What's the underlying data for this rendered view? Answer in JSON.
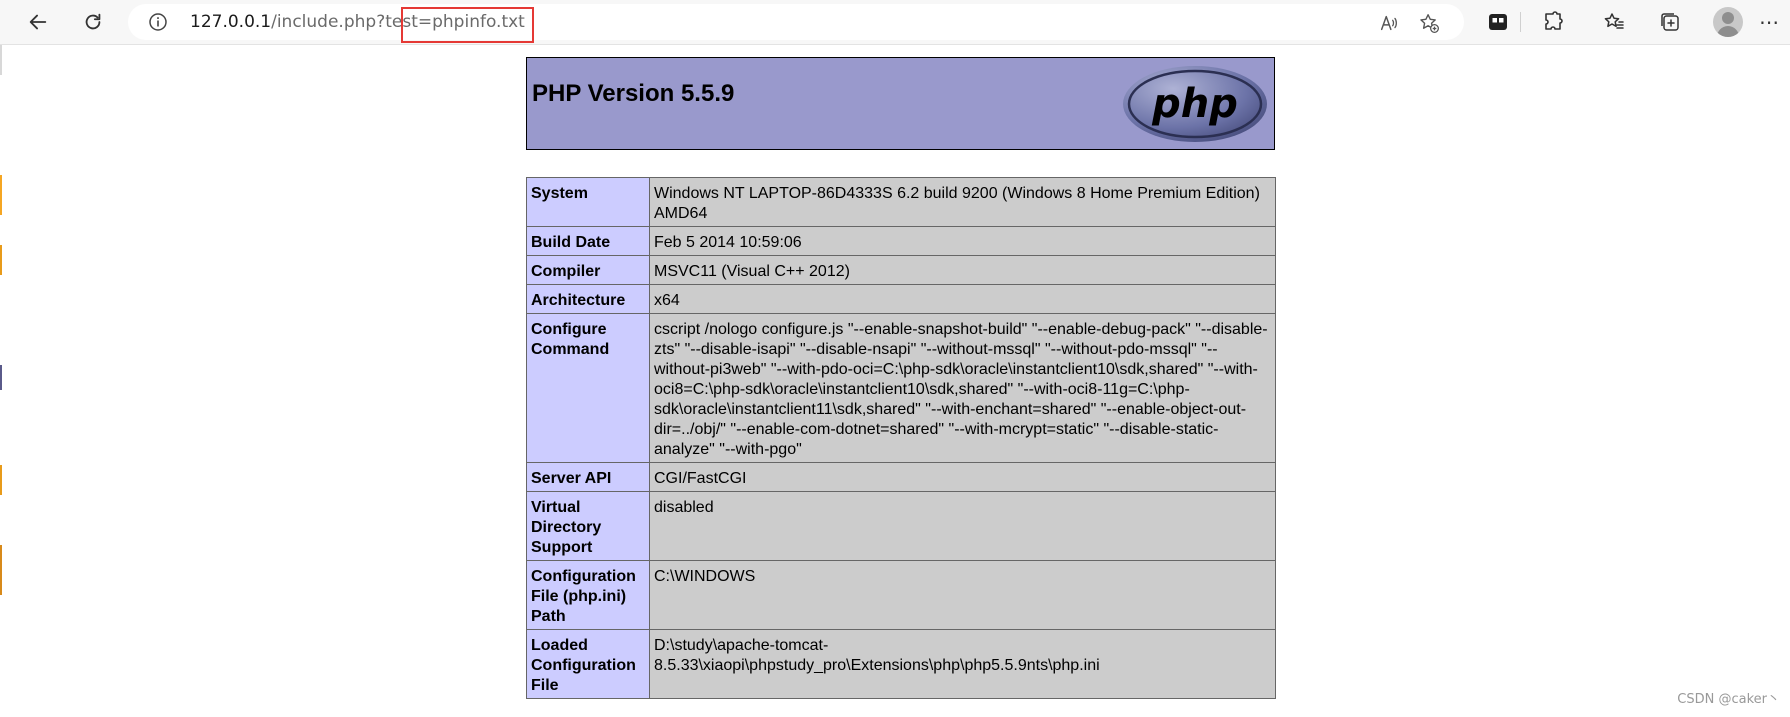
{
  "browser": {
    "url_host": "127.0.0.1",
    "url_path": "/include.php?test=",
    "url_param": "phpinfo.txt"
  },
  "php": {
    "version_title": "PHP Version 5.5.9",
    "logo_text": "php",
    "rows": [
      {
        "key": "System",
        "value": "Windows NT LAPTOP-86D4333S 6.2 build 9200 (Windows 8 Home Premium Edition) AMD64"
      },
      {
        "key": "Build Date",
        "value": "Feb 5 2014 10:59:06"
      },
      {
        "key": "Compiler",
        "value": "MSVC11 (Visual C++ 2012)"
      },
      {
        "key": "Architecture",
        "value": "x64"
      },
      {
        "key": "Configure Command",
        "value": "cscript /nologo configure.js \"--enable-snapshot-build\" \"--enable-debug-pack\" \"--disable-zts\" \"--disable-isapi\" \"--disable-nsapi\" \"--without-mssql\" \"--without-pdo-mssql\" \"--without-pi3web\" \"--with-pdo-oci=C:\\php-sdk\\oracle\\instantclient10\\sdk,shared\" \"--with-oci8=C:\\php-sdk\\oracle\\instantclient10\\sdk,shared\" \"--with-oci8-11g=C:\\php-sdk\\oracle\\instantclient11\\sdk,shared\" \"--with-enchant=shared\" \"--enable-object-out-dir=../obj/\" \"--enable-com-dotnet=shared\" \"--with-mcrypt=static\" \"--disable-static-analyze\" \"--with-pgo\""
      },
      {
        "key": "Server API",
        "value": "CGI/FastCGI"
      },
      {
        "key": "Virtual Directory Support",
        "value": "disabled"
      },
      {
        "key": "Configuration File (php.ini) Path",
        "value": "C:\\WINDOWS"
      },
      {
        "key": "Loaded Configuration File",
        "value": "D:\\study\\apache-tomcat-8.5.33\\xiaopi\\phpstudy_pro\\Extensions\\php\\php5.5.9nts\\php.ini"
      }
    ]
  },
  "watermark": "CSDN @caker丶",
  "colors": {
    "header_bg": "#9999cc",
    "key_bg": "#ccccff",
    "value_bg": "#cccccc",
    "highlight": "#e53935"
  }
}
